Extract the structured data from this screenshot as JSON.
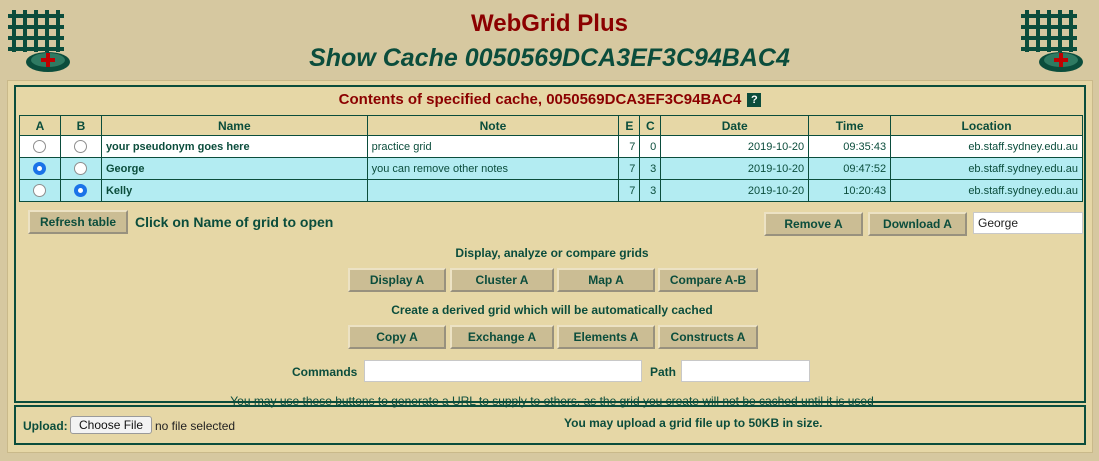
{
  "header": {
    "app_title": "WebGrid Plus",
    "page_title": "Show Cache 0050569DCA3EF3C94BAC4"
  },
  "cache": {
    "title": "Contents of specified cache, 0050569DCA3EF3C94BAC4",
    "help_glyph": "?",
    "columns": [
      "A",
      "B",
      "Name",
      "Note",
      "E",
      "C",
      "Date",
      "Time",
      "Location"
    ],
    "rows": [
      {
        "a_selected": false,
        "b_selected": false,
        "name": "your pseudonym goes here",
        "note": "practice grid",
        "e": "7",
        "c": "0",
        "date": "2019-10-20",
        "time": "09:35:43",
        "location": "eb.staff.sydney.edu.au"
      },
      {
        "a_selected": true,
        "b_selected": false,
        "name": "George",
        "note": "you can remove other notes",
        "e": "7",
        "c": "3",
        "date": "2019-10-20",
        "time": "09:47:52",
        "location": "eb.staff.sydney.edu.au"
      },
      {
        "a_selected": false,
        "b_selected": true,
        "name": "Kelly",
        "note": "",
        "e": "7",
        "c": "3",
        "date": "2019-10-20",
        "time": "10:20:43",
        "location": "eb.staff.sydney.edu.au"
      }
    ]
  },
  "toolbar": {
    "refresh_label": "Refresh table",
    "hint": "Click on Name of grid to open",
    "remove_label": "Remove A",
    "download_label": "Download A",
    "name_value": "George"
  },
  "analyze": {
    "heading": "Display, analyze or compare grids",
    "buttons": [
      "Display A",
      "Cluster A",
      "Map A",
      "Compare A-B"
    ]
  },
  "derive": {
    "heading": "Create a derived grid which will be automatically cached",
    "buttons": [
      "Copy A",
      "Exchange A",
      "Elements A",
      "Constructs A"
    ]
  },
  "commands": {
    "commands_label": "Commands",
    "commands_value": "",
    "path_label": "Path",
    "path_value": "",
    "info": "You may use these buttons to generate a URL to supply to others, as the grid you create will not be cached until it is used"
  },
  "upload": {
    "label": "Upload:",
    "choose_label": "Choose File",
    "status": "no file selected",
    "limit_note": "You may upload a grid file up to 50KB in size."
  },
  "colors": {
    "accent_red": "#8b0000",
    "accent_green": "#0b4d3c",
    "selected_row": "#b3ecf2",
    "panel": "#e6d7a6",
    "background": "#d6c8a0"
  }
}
